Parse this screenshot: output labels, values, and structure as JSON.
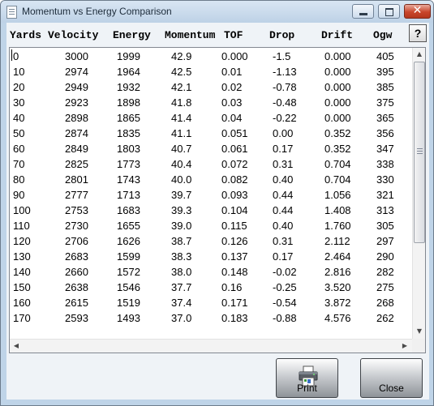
{
  "window": {
    "title": "Momentum vs Energy Comparison",
    "controls": {
      "minimize": "",
      "maximize": "",
      "close": "✕"
    }
  },
  "header": {
    "columns": [
      "Yards",
      "Velocity",
      "Energy",
      "Momentum",
      "TOF",
      "Drop",
      "Drift",
      "Ogw"
    ],
    "help_label": "?"
  },
  "table": {
    "rows": [
      [
        "0",
        "3000",
        "1999",
        "42.9",
        "0.000",
        "-1.5",
        "0.000",
        "405"
      ],
      [
        "10",
        "2974",
        "1964",
        "42.5",
        "0.01",
        "-1.13",
        "0.000",
        "395"
      ],
      [
        "20",
        "2949",
        "1932",
        "42.1",
        "0.02",
        "-0.78",
        "0.000",
        "385"
      ],
      [
        "30",
        "2923",
        "1898",
        "41.8",
        "0.03",
        "-0.48",
        "0.000",
        "375"
      ],
      [
        "40",
        "2898",
        "1865",
        "41.4",
        "0.04",
        "-0.22",
        "0.000",
        "365"
      ],
      [
        "50",
        "2874",
        "1835",
        "41.1",
        "0.051",
        "0.00",
        "0.352",
        "356"
      ],
      [
        "60",
        "2849",
        "1803",
        "40.7",
        "0.061",
        "0.17",
        "0.352",
        "347"
      ],
      [
        "70",
        "2825",
        "1773",
        "40.4",
        "0.072",
        "0.31",
        "0.704",
        "338"
      ],
      [
        "80",
        "2801",
        "1743",
        "40.0",
        "0.082",
        "0.40",
        "0.704",
        "330"
      ],
      [
        "90",
        "2777",
        "1713",
        "39.7",
        "0.093",
        "0.44",
        "1.056",
        "321"
      ],
      [
        "100",
        "2753",
        "1683",
        "39.3",
        "0.104",
        "0.44",
        "1.408",
        "313"
      ],
      [
        "110",
        "2730",
        "1655",
        "39.0",
        "0.115",
        "0.40",
        "1.760",
        "305"
      ],
      [
        "120",
        "2706",
        "1626",
        "38.7",
        "0.126",
        "0.31",
        "2.112",
        "297"
      ],
      [
        "130",
        "2683",
        "1599",
        "38.3",
        "0.137",
        "0.17",
        "2.464",
        "290"
      ],
      [
        "140",
        "2660",
        "1572",
        "38.0",
        "0.148",
        "-0.02",
        "2.816",
        "282"
      ],
      [
        "150",
        "2638",
        "1546",
        "37.7",
        "0.16",
        "-0.25",
        "3.520",
        "275"
      ],
      [
        "160",
        "2615",
        "1519",
        "37.4",
        "0.171",
        "-0.54",
        "3.872",
        "268"
      ],
      [
        "170",
        "2593",
        "1493",
        "37.0",
        "0.183",
        "-0.88",
        "4.576",
        "262"
      ]
    ]
  },
  "scrollbars": {
    "up": "▲",
    "down": "▼",
    "left": "◀",
    "right": "▶"
  },
  "buttons": {
    "print_label": "Print",
    "close_label": "Close"
  },
  "icons": {
    "app": "document-icon",
    "printer": "printer-icon"
  },
  "colors": {
    "titlebar": "#bdd1e6",
    "close_button": "#c9462c",
    "panel": "#eff3f7"
  }
}
